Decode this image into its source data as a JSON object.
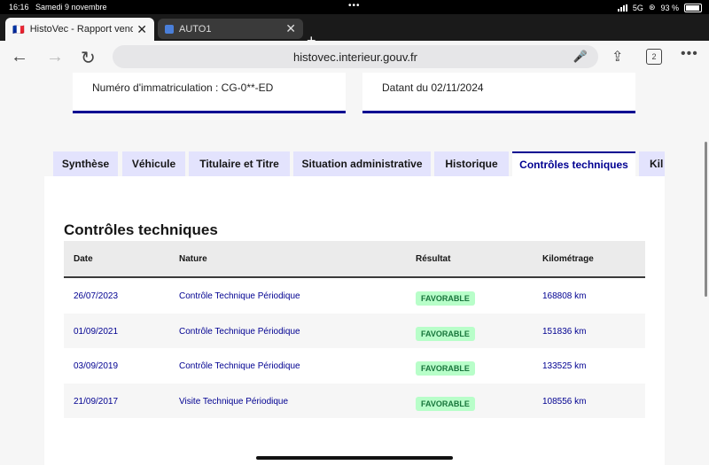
{
  "statusbar": {
    "time": "16:16",
    "date": "Samedi 9 novembre",
    "network": "5G",
    "battery": "93 %"
  },
  "browser_tabs": [
    {
      "flag": "🇫🇷",
      "label": "HistoVec - Rapport vendeur",
      "close": "✕"
    },
    {
      "label": "AUTO1",
      "close": "✕"
    }
  ],
  "new_tab": "+",
  "toolbar": {
    "url": "histovec.interieur.gouv.fr",
    "tab_count": "2"
  },
  "cards": {
    "plate": "Numéro d'immatriculation : CG-0**-ED",
    "date": "Datant du 02/11/2024"
  },
  "section_tabs": [
    "Synthèse",
    "Véhicule",
    "Titulaire et Titre",
    "Situation administrative",
    "Historique",
    "Contrôles techniques",
    "Kil"
  ],
  "section": {
    "title": "Contrôles techniques",
    "headers": [
      "Date",
      "Nature",
      "Résultat",
      "Kilométrage"
    ],
    "rows": [
      {
        "date": "26/07/2023",
        "nature": "Contrôle Technique Périodique",
        "result": "FAVORABLE",
        "km": "168808 km"
      },
      {
        "date": "01/09/2021",
        "nature": "Contrôle Technique Périodique",
        "result": "FAVORABLE",
        "km": "151836 km"
      },
      {
        "date": "03/09/2019",
        "nature": "Contrôle Technique Périodique",
        "result": "FAVORABLE",
        "km": "133525 km"
      },
      {
        "date": "21/09/2017",
        "nature": "Visite Technique Périodique",
        "result": "FAVORABLE",
        "km": "108556 km"
      }
    ]
  },
  "colors": {
    "accent": "#000091",
    "tab_bg": "#e3e3fd",
    "badge_bg": "#b8fec9",
    "badge_text": "#18753c"
  }
}
